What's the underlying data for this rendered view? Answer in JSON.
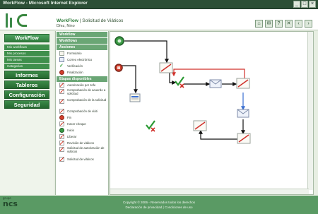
{
  "window": {
    "title": "WorkFlow - Microsoft Internet Explorer",
    "controls": [
      "_",
      "□",
      "×"
    ]
  },
  "header": {
    "app": "WorkFlow",
    "separator": "|",
    "page": "Solicitud de Viáticos",
    "user": "Díez, Nino",
    "tools": [
      "⌂",
      "✉",
      "?",
      "✕",
      "‹",
      "›"
    ]
  },
  "nav": {
    "workflow": "WorkFlow",
    "subitems": [
      "Mis workflows",
      "Mis procesos",
      "Mis tareas",
      "Categorías"
    ],
    "informes": "Informes",
    "tableros": "Tableros",
    "configuracion": "Configuración",
    "seguridad": "Seguridad"
  },
  "palette": {
    "headers": [
      "Workflow",
      "Workflows",
      "Acciones",
      "Etapas disponibles"
    ],
    "items_top": [
      {
        "label": "Formulario",
        "icon": "document-icon"
      },
      {
        "label": "Correo electrónico",
        "icon": "mail-icon"
      },
      {
        "label": "Verificación",
        "icon": "check-icon"
      },
      {
        "label": "Finalización",
        "icon": "stop-icon"
      }
    ],
    "items_bottom": [
      {
        "label": "Autorización por Jefe",
        "icon": "pen-icon"
      },
      {
        "label": "Comprobación de acuerdo a solicitud",
        "icon": "pen-icon"
      },
      {
        "label": "Comprobación de la solicitud",
        "icon": "pen-icon"
      },
      {
        "label": "Comprobación de viáti",
        "icon": "pen-icon"
      },
      {
        "label": "Fin",
        "icon": "stop-icon"
      },
      {
        "label": "Hacer cheque",
        "icon": "pen-icon"
      },
      {
        "label": "Inicio",
        "icon": "start-icon"
      },
      {
        "label": "Liberar",
        "icon": "pen-icon"
      },
      {
        "label": "Revisión de viáticos",
        "icon": "pen-icon"
      },
      {
        "label": "Solicitud de autorización de viáticos",
        "icon": "pen-icon"
      },
      {
        "label": "Solicitud de viáticos",
        "icon": "pen-icon"
      }
    ]
  },
  "footer": {
    "brand": "ncs",
    "brand_small": "grupo",
    "copyright": "Copyright © 2006 - Reservados todos los derechos",
    "links": "Declaración de privacidad | Condiciones de uso"
  },
  "colors": {
    "accent": "#2f7c3c",
    "flow_line": "#111111",
    "reject_line": "#d0302a",
    "alt_line": "#3a6fd1"
  }
}
